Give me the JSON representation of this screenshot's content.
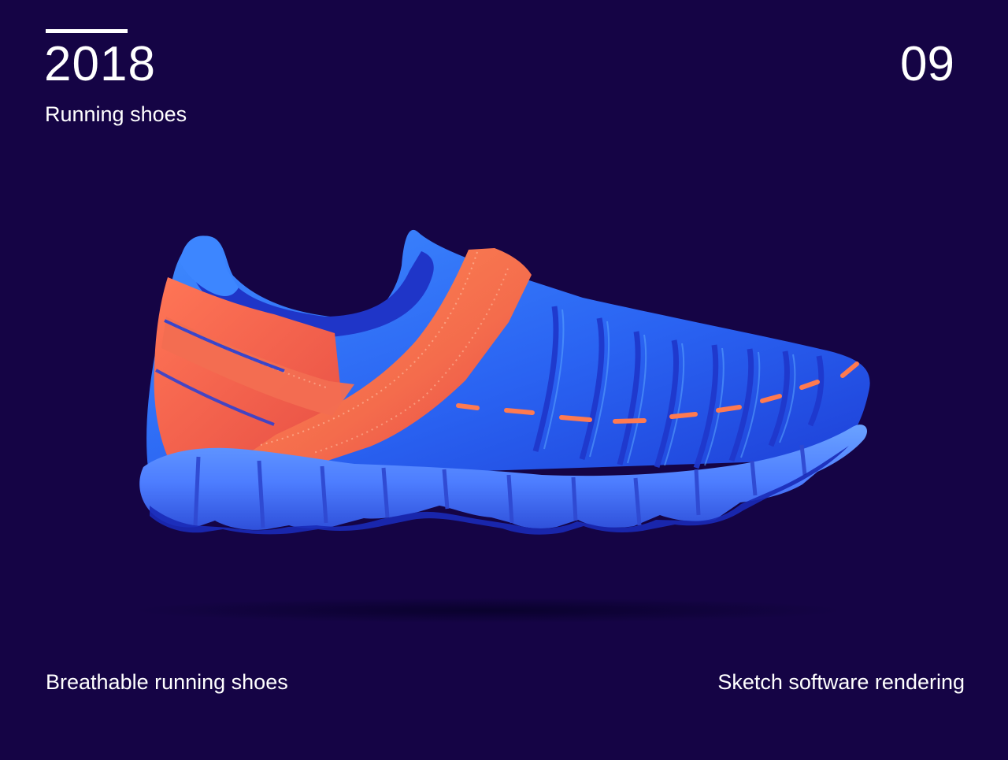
{
  "header": {
    "year": "2018",
    "subtitle": "Running shoes",
    "page_number": "09"
  },
  "footer": {
    "left_caption": "Breathable running shoes",
    "right_caption": "Sketch software rendering"
  },
  "colors": {
    "background": "#150445",
    "text": "#ffffff",
    "shoe_blue": "#2a63f2",
    "shoe_orange": "#f6694d",
    "sole_blue": "#5a88ff"
  },
  "illustration": {
    "subject_icon": "running-shoe-illustration"
  }
}
